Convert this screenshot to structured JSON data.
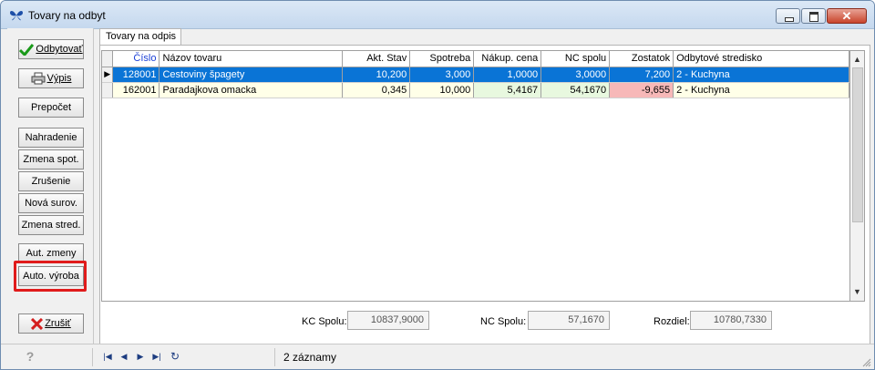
{
  "window": {
    "title": "Tovary na odbyt"
  },
  "left_buttons": [
    {
      "label": "Odbytovať",
      "icon": "checkmark-icon"
    },
    {
      "label": "Výpis",
      "icon": "printer-icon"
    },
    {
      "label": "Prepočet"
    },
    {
      "label": "Nahradenie"
    },
    {
      "label": "Zmena spot."
    },
    {
      "label": "Zrušenie"
    },
    {
      "label": "Nová surov."
    },
    {
      "label": "Zmena stred."
    },
    {
      "label": "Aut. zmeny"
    },
    {
      "label": "Auto. výroba"
    },
    {
      "label": "Zrušiť",
      "icon": "cross-icon"
    }
  ],
  "tab": {
    "label": "Tovary na odpis"
  },
  "table": {
    "columns": [
      "Číslo",
      "Názov tovaru",
      "Akt. Stav",
      "Spotreba",
      "Nákup. cena",
      "NC spolu",
      "Zostatok",
      "Odbytové stredisko"
    ],
    "rows": [
      {
        "cislo": "128001",
        "nazov": "Cestoviny špagety",
        "akt_stav": "10,200",
        "spotreba": "3,000",
        "nakup_cena": "1,0000",
        "nc_spolu": "3,0000",
        "zostatok": "7,200",
        "stredisko": "2 - Kuchyna",
        "selected": true
      },
      {
        "cislo": "162001",
        "nazov": "Paradajkova omacka",
        "akt_stav": "0,345",
        "spotreba": "10,000",
        "nakup_cena": "5,4167",
        "nc_spolu": "54,1670",
        "zostatok": "-9,655",
        "stredisko": "2 - Kuchyna",
        "selected": false
      }
    ]
  },
  "totals": {
    "kc_label": "KC Spolu:",
    "kc_value": "10837,9000",
    "nc_label": "NC Spolu:",
    "nc_value": "57,1670",
    "rozdiel_label": "Rozdiel:",
    "rozdiel_value": "10780,7330"
  },
  "status": {
    "records": "2 záznamy"
  },
  "colors": {
    "selection": "#0a74d6",
    "negative": "#f7b8b8",
    "highlight_box": "#e01b1b"
  }
}
